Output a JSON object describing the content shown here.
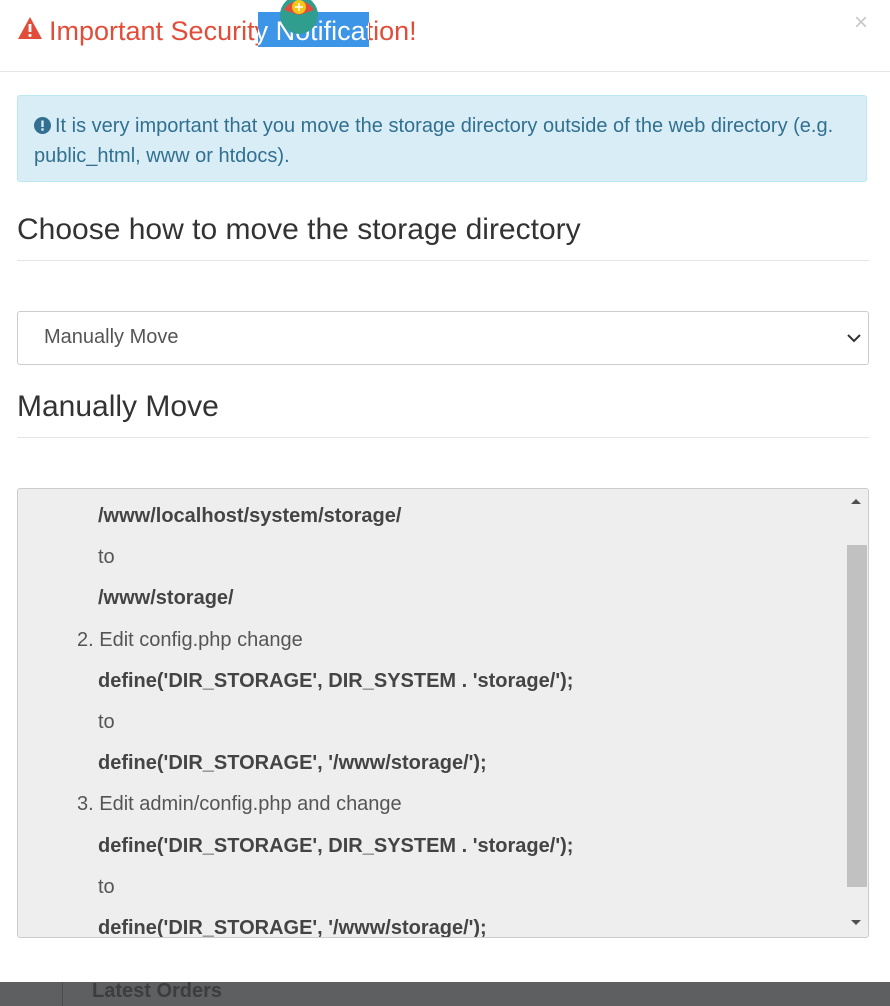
{
  "modal": {
    "title": "Important Security Notification!",
    "close_label": "×"
  },
  "alert": {
    "text": "It is very important that you move the storage directory outside of the web directory (e.g. public_html, www or htdocs)."
  },
  "sections": {
    "choose_heading": "Choose how to move the storage directory",
    "manual_heading": "Manually Move"
  },
  "select": {
    "value": "Manually Move"
  },
  "instructions": {
    "lines": [
      {
        "text": "/www/localhost/system/storage/",
        "style": "bold"
      },
      {
        "text": "to",
        "style": "normal"
      },
      {
        "text": "/www/storage/",
        "style": "bold"
      },
      {
        "text": "2. Edit config.php change",
        "style": "item"
      },
      {
        "text": "define('DIR_STORAGE', DIR_SYSTEM . 'storage/');",
        "style": "bold"
      },
      {
        "text": "to",
        "style": "normal"
      },
      {
        "text": "define('DIR_STORAGE', '/www/storage/');",
        "style": "bold"
      },
      {
        "text": "3. Edit admin/config.php and change",
        "style": "item"
      },
      {
        "text": "define('DIR_STORAGE', DIR_SYSTEM . 'storage/');",
        "style": "bold"
      },
      {
        "text": "to",
        "style": "normal"
      },
      {
        "text": "define('DIR_STORAGE', '/www/storage/');",
        "style": "bold"
      }
    ]
  },
  "background": {
    "partial_label": "Latest Orders"
  },
  "colors": {
    "title_red": "#e24d3a",
    "alert_bg": "#d9edf7",
    "alert_text": "#31708f",
    "selection_blue": "#1a82e2"
  },
  "icons": {
    "title": "warning-triangle-icon",
    "alert": "exclamation-circle-icon",
    "select": "chevron-down-icon",
    "badge": "extension-badge-icon"
  }
}
